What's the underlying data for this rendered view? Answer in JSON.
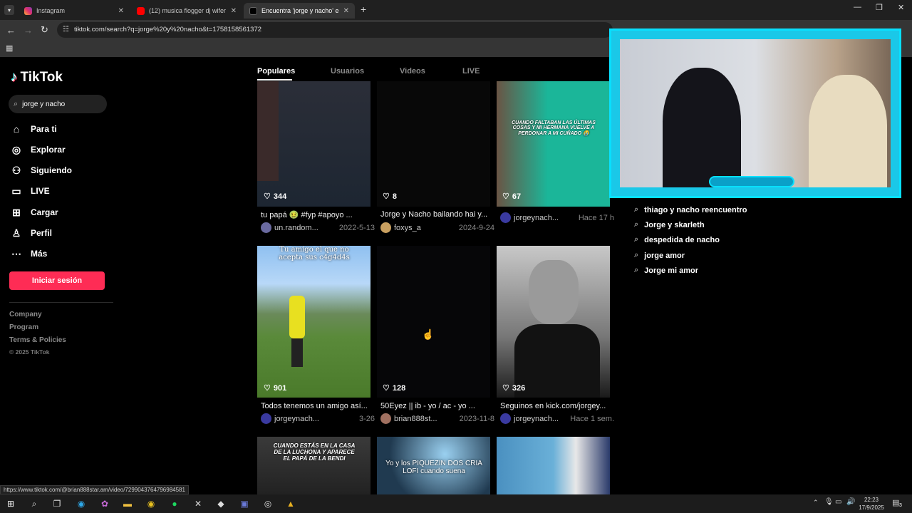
{
  "browser": {
    "tabs": [
      {
        "title": "Instagram",
        "close": "✕"
      },
      {
        "title": "(12) musica flogger dj wifer - Yo",
        "close": "✕"
      },
      {
        "title": "Encuentra 'jorge y nacho' en Ti",
        "close": "✕"
      }
    ],
    "new_tab": "+",
    "url": "tiktok.com/search?q=jorge%20y%20nacho&t=1758158561372",
    "status_url": "https://www.tiktok.com/@brian888star.am/video/7299043764796984581"
  },
  "sidebar": {
    "logo": "TikTok",
    "search_value": "jorge y nacho",
    "items": [
      {
        "label": "Para ti",
        "icon": "home-icon"
      },
      {
        "label": "Explorar",
        "icon": "compass-icon"
      },
      {
        "label": "Siguiendo",
        "icon": "following-icon"
      },
      {
        "label": "LIVE",
        "icon": "live-icon"
      },
      {
        "label": "Cargar",
        "icon": "upload-icon"
      },
      {
        "label": "Perfil",
        "icon": "profile-icon"
      },
      {
        "label": "Más",
        "icon": "more-icon"
      }
    ],
    "login_button": "Iniciar sesión",
    "footer_links": [
      "Company",
      "Program",
      "Terms & Policies"
    ],
    "copyright": "© 2025 TikTok"
  },
  "results_tabs": [
    "Populares",
    "Usuarios",
    "Videos",
    "LIVE"
  ],
  "videos": [
    {
      "likes": "344",
      "caption": "tu papá 🤢 #fyp #apoyo ...",
      "author": "un.random...",
      "date": "2022-5-13"
    },
    {
      "likes": "8",
      "caption": "Jorge y Nacho bailando hai y...",
      "author": "foxys_a",
      "date": "2024-9-24"
    },
    {
      "likes": "67",
      "caption": "",
      "author": "jorgeynach...",
      "date": "Hace 17 h",
      "overlay": "CUANDO FALTABAN LAS ÚLTIMAS COSAS Y MI HERMANA VUELVE A PERDONAR A MI CUÑADO 😭"
    },
    {
      "likes": "901",
      "caption": "Todos tenemos un amigo así...",
      "author": "jorgeynach...",
      "date": "3-26",
      "overlay": "Tu amigo el que no acepta sus c4g4d4s"
    },
    {
      "likes": "128",
      "caption": "50Eyez || ib - yo / ac - yo ...",
      "author": "brian888st...",
      "date": "2023-11-8"
    },
    {
      "likes": "326",
      "caption": "Seguinos en kick.com/jorgey...",
      "author": "jorgeynach...",
      "date": "Hace 1 sem."
    },
    {
      "overlay": "CUANDO ESTÁS EN LA CASA DE LA LUCHONA Y APARECE EL PAPÁ DE LA BENDI"
    },
    {
      "overlay": "Yo y los PIQUEZIN DOS CRIA LOFI cuando suena"
    },
    {
      "overlay": ""
    }
  ],
  "suggestions": [
    "thiago y nacho reencuentro",
    "Jorge y skarleth",
    "despedida de nacho",
    "jorge amor",
    "Jorge mi amor"
  ],
  "clock": {
    "time": "22:23",
    "date": "17/9/2025"
  },
  "notif_count": "3",
  "colors": {
    "accent": "#fe2c55",
    "hashtag": "#8da8ff",
    "webcam_frame": "#1ac8e8"
  }
}
